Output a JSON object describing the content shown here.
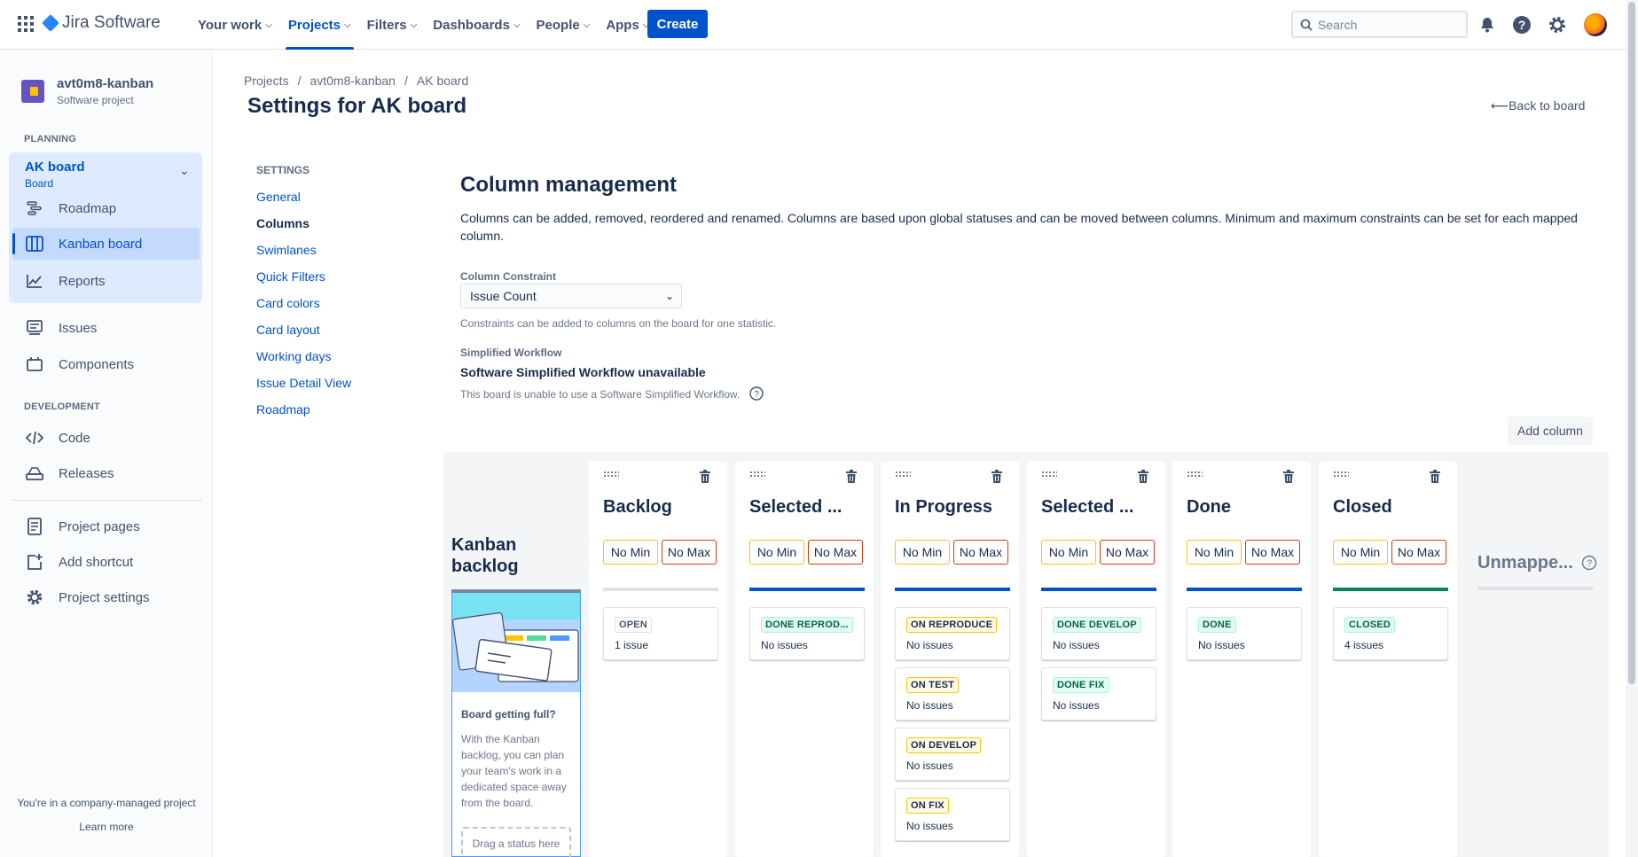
{
  "topnav": {
    "brand": "Jira Software",
    "items": [
      {
        "label": "Your work"
      },
      {
        "label": "Projects"
      },
      {
        "label": "Filters"
      },
      {
        "label": "Dashboards"
      },
      {
        "label": "People"
      },
      {
        "label": "Apps"
      }
    ],
    "create_label": "Create",
    "search_placeholder": "Search",
    "accent": "#0052cc"
  },
  "sidebar": {
    "project_name": "avt0m8-kanban",
    "project_type": "Software project",
    "planning_heading": "PLANNING",
    "board_name": "AK board",
    "board_sub": "Board",
    "planning_items": [
      {
        "label": "Roadmap",
        "icon": "roadmap-icon"
      },
      {
        "label": "Kanban board",
        "icon": "board-icon"
      },
      {
        "label": "Reports",
        "icon": "reports-icon"
      }
    ],
    "other_items": [
      {
        "label": "Issues",
        "icon": "issues-icon"
      },
      {
        "label": "Components",
        "icon": "components-icon"
      }
    ],
    "development_heading": "DEVELOPMENT",
    "dev_items": [
      {
        "label": "Code",
        "icon": "code-icon"
      },
      {
        "label": "Releases",
        "icon": "releases-icon"
      }
    ],
    "bottom_items": [
      {
        "label": "Project pages",
        "icon": "pages-icon"
      },
      {
        "label": "Add shortcut",
        "icon": "add-shortcut-icon"
      },
      {
        "label": "Project settings",
        "icon": "gear-icon"
      }
    ],
    "footer_text": "You're in a company-managed project",
    "footer_link": "Learn more"
  },
  "breadcrumb": [
    "Projects",
    "/",
    "avt0m8-kanban",
    "/",
    "AK board"
  ],
  "page_title": "Settings for AK board",
  "back_to_board": "Back to board",
  "settings_nav": {
    "heading": "SETTINGS",
    "items": [
      "General",
      "Columns",
      "Swimlanes",
      "Quick Filters",
      "Card colors",
      "Card layout",
      "Working days",
      "Issue Detail View",
      "Roadmap"
    ],
    "current": "Columns"
  },
  "column_management": {
    "title": "Column management",
    "description": "Columns can be added, removed, reordered and renamed. Columns are based upon global statuses and can be moved between columns. Minimum and maximum constraints can be set for each mapped column.",
    "constraint_label": "Column Constraint",
    "constraint_value": "Issue Count",
    "constraint_help": "Constraints can be added to columns on the board for one statistic.",
    "simplified_label": "Simplified Workflow",
    "simplified_title": "Software Simplified Workflow unavailable",
    "simplified_help": "This board is unable to use a Software Simplified Workflow.",
    "add_column": "Add column"
  },
  "kanban_backlog": {
    "title": "Kanban backlog",
    "heading": "Board getting full?",
    "text": "With the Kanban backlog, you can plan your team's work in a dedicated space away from the board.",
    "drop_text": "Drag a status here"
  },
  "columns": [
    {
      "name": "Backlog",
      "min": "No Min",
      "max": "No Max",
      "bar_color": "#dfe1e6",
      "statuses": [
        {
          "label": "OPEN",
          "count": "1 issue",
          "kind": "todo"
        }
      ]
    },
    {
      "name": "Selected ...",
      "min": "No Min",
      "max": "No Max",
      "bar_color": "#0052cc",
      "statuses": [
        {
          "label": "DONE REPROD...",
          "count": "No issues",
          "kind": "done"
        }
      ]
    },
    {
      "name": "In Progress",
      "min": "No Min",
      "max": "No Max",
      "bar_color": "#0052cc",
      "statuses": [
        {
          "label": "ON REPRODUCE",
          "count": "No issues",
          "kind": "prog"
        },
        {
          "label": "ON TEST",
          "count": "No issues",
          "kind": "prog"
        },
        {
          "label": "ON DEVELOP",
          "count": "No issues",
          "kind": "prog"
        },
        {
          "label": "ON FIX",
          "count": "No issues",
          "kind": "prog"
        }
      ]
    },
    {
      "name": "Selected ...",
      "min": "No Min",
      "max": "No Max",
      "bar_color": "#0052cc",
      "statuses": [
        {
          "label": "DONE DEVELOP",
          "count": "No issues",
          "kind": "done"
        },
        {
          "label": "DONE FIX",
          "count": "No issues",
          "kind": "done"
        }
      ]
    },
    {
      "name": "Done",
      "min": "No Min",
      "max": "No Max",
      "bar_color": "#0052cc",
      "statuses": [
        {
          "label": "DONE",
          "count": "No issues",
          "kind": "done"
        }
      ]
    },
    {
      "name": "Closed",
      "min": "No Min",
      "max": "No Max",
      "bar_color": "#00875a",
      "statuses": [
        {
          "label": "CLOSED",
          "count": "4 issues",
          "kind": "done"
        }
      ]
    }
  ],
  "unmapped": "Unmappe..."
}
